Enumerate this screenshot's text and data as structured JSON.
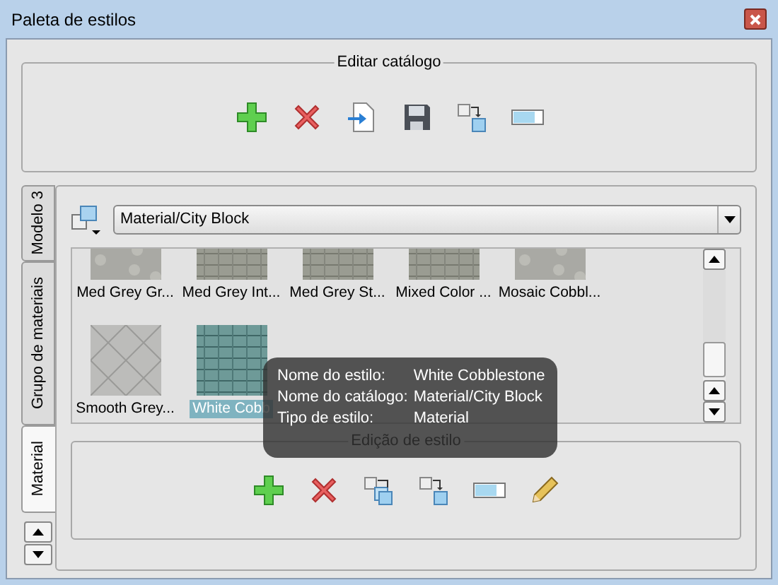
{
  "window": {
    "title": "Paleta de estilos"
  },
  "catalog_group": {
    "title": "Editar catálogo",
    "tools": [
      {
        "kind": "add"
      },
      {
        "kind": "delete"
      },
      {
        "kind": "import"
      },
      {
        "kind": "save"
      },
      {
        "kind": "copy"
      },
      {
        "kind": "rename"
      }
    ]
  },
  "side_tabs": [
    {
      "label": "Modelo 3",
      "selected": false
    },
    {
      "label": "Grupo de materiais",
      "selected": false
    },
    {
      "label": "Material",
      "selected": true
    }
  ],
  "catalog_dropdown": {
    "value": "Material/City Block"
  },
  "styles": [
    {
      "label": "Med Grey Gr...",
      "selected": false,
      "kind": "gravel"
    },
    {
      "label": "Med Grey Int...",
      "selected": false,
      "kind": "brick"
    },
    {
      "label": "Med Grey St...",
      "selected": false,
      "kind": "brick"
    },
    {
      "label": "Mixed Color ...",
      "selected": false,
      "kind": "brick"
    },
    {
      "label": "Mosaic Cobbl...",
      "selected": false,
      "kind": "gravel"
    },
    {
      "label": "Smooth Grey...",
      "selected": false,
      "kind": "diamond"
    },
    {
      "label": "White Cobb",
      "selected": true,
      "kind": "cobble"
    }
  ],
  "tooltip": [
    {
      "key": "Nome do estilo:",
      "value": "White Cobblestone"
    },
    {
      "key": "Nome do catálogo:",
      "value": "Material/City Block"
    },
    {
      "key": "Tipo de estilo:",
      "value": "Material"
    }
  ],
  "style_group": {
    "title": "Edição de estilo",
    "tools": [
      {
        "kind": "add"
      },
      {
        "kind": "delete"
      },
      {
        "kind": "duplicate"
      },
      {
        "kind": "copy"
      },
      {
        "kind": "rename"
      },
      {
        "kind": "edit"
      }
    ]
  }
}
